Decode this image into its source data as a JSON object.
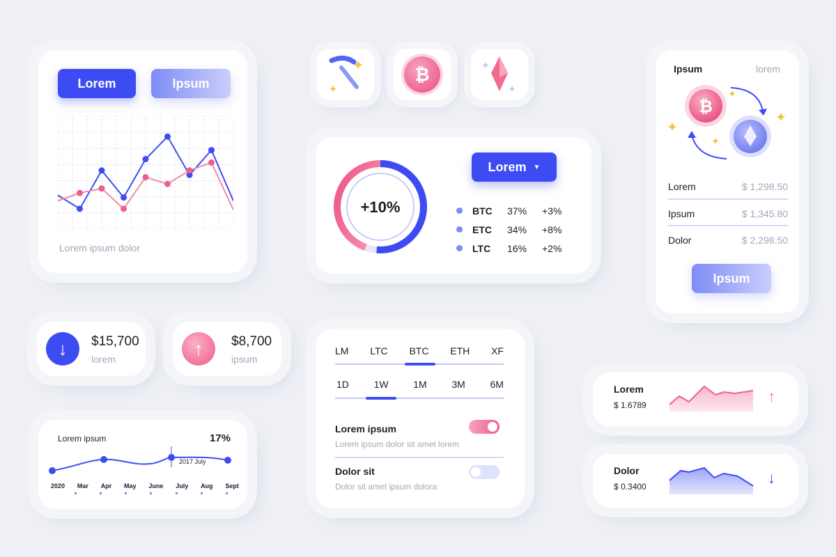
{
  "chart_card": {
    "tab_active": "Lorem",
    "tab_inactive": "Ipsum",
    "caption": "Lorem ipsum dolor"
  },
  "icons": {
    "mining": "pickaxe-icon",
    "bitcoin": "bitcoin-icon",
    "ethereum": "ethereum-crystal-icon"
  },
  "donut_card": {
    "center_label": "+10%",
    "dropdown_label": "Lorem",
    "legend": [
      {
        "symbol": "BTC",
        "share": "37%",
        "change": "+3%"
      },
      {
        "symbol": "ETC",
        "share": "34%",
        "change": "+8%"
      },
      {
        "symbol": "LTC",
        "share": "16%",
        "change": "+2%"
      }
    ]
  },
  "exchange_card": {
    "tab_active": "Ipsum",
    "tab_inactive": "lorem",
    "rows": [
      {
        "label": "Lorem",
        "value": "$ 1,298.50"
      },
      {
        "label": "Ipsum",
        "value": "$ 1,345.80"
      },
      {
        "label": "Dolor",
        "value": "$ 2,298.50"
      }
    ],
    "button_label": "Ipsum"
  },
  "stat_down": {
    "amount": "$15,700",
    "label": "lorem"
  },
  "stat_up": {
    "amount": "$8,700",
    "label": "ipsum"
  },
  "timeline_card": {
    "title": "Lorem ipsum",
    "percent": "17%",
    "tooltip": "2017 July",
    "months": [
      "2020",
      "Mar",
      "Apr",
      "May",
      "June",
      "July",
      "Aug",
      "Sept"
    ]
  },
  "filter_card": {
    "coins": [
      "LM",
      "LTC",
      "BTC",
      "ETH",
      "XF"
    ],
    "periods": [
      "1D",
      "1W",
      "1M",
      "3M",
      "6M"
    ],
    "settings": [
      {
        "title": "Lorem ipsum",
        "desc": "Lorem ipsum dolor sit amet lorem",
        "on": true
      },
      {
        "title": "Dolor sit",
        "desc": "Dolor sit amet ipsum dolora",
        "on": false
      }
    ]
  },
  "ticker_up": {
    "name": "Lorem",
    "price": "$ 1.6789"
  },
  "ticker_down": {
    "name": "Dolor",
    "price": "$ 0.3400"
  },
  "chart_data": {
    "type": "line",
    "title": "",
    "x": [
      1,
      2,
      3,
      4,
      5,
      6,
      7,
      8,
      9
    ],
    "series": [
      {
        "values": [
          30,
          18,
          52,
          28,
          62,
          82,
          48,
          70,
          25
        ],
        "color": "#3d4cf2"
      },
      {
        "values": [
          25,
          32,
          36,
          18,
          46,
          40,
          52,
          59,
          17
        ],
        "color": "#f18aa9"
      }
    ],
    "ylim": [
      0,
      100
    ],
    "grid": true
  },
  "colors": {
    "primary": "#3d4cf2",
    "pink": "#f06590",
    "soft": "#7f8cf5"
  }
}
